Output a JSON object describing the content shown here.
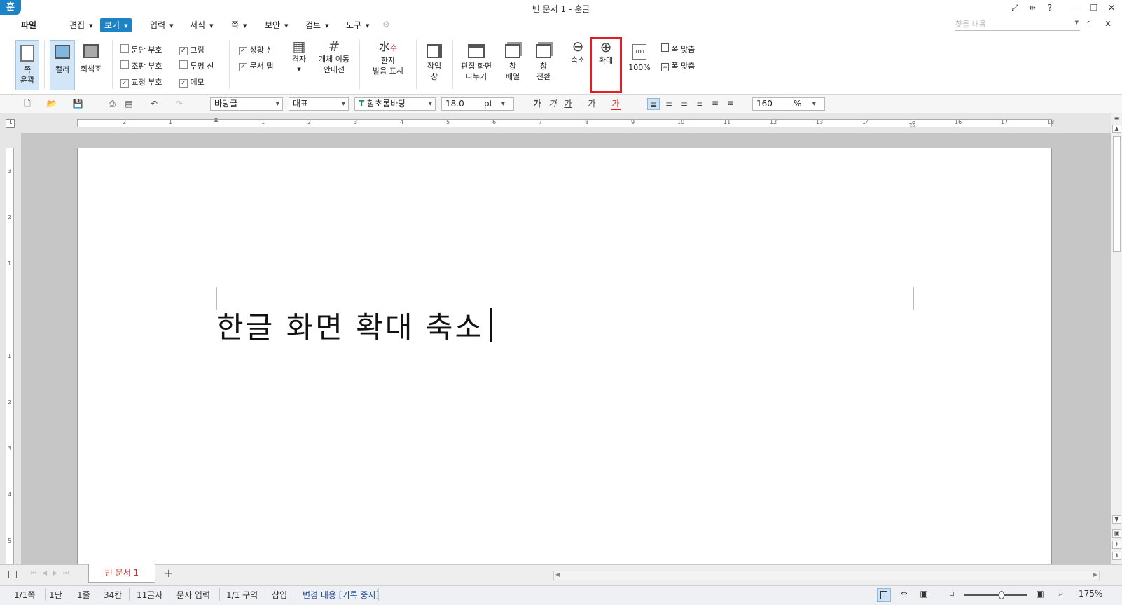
{
  "window": {
    "title": "빈 문서 1 - 훈글",
    "logo": "훈"
  },
  "title_controls": {
    "fit": "⤢",
    "split": "⇹",
    "help": "?",
    "minimize": "—",
    "restore": "❐",
    "close": "✕"
  },
  "menu": {
    "items": [
      "파일",
      "편집",
      "보기",
      "입력",
      "서식",
      "쪽",
      "보안",
      "검토",
      "도구"
    ],
    "active": "보기",
    "search_placeholder": "찾을 내용"
  },
  "ribbon": {
    "page_outline": "쪽\n윤곽",
    "color": "컬러",
    "grayscale": "회색조",
    "checks": [
      {
        "label": "문단 부호",
        "checked": false
      },
      {
        "label": "조판 부호",
        "checked": false
      },
      {
        "label": "교정 부호",
        "checked": true
      },
      {
        "label": "그림",
        "checked": true
      },
      {
        "label": "투명 선",
        "checked": false
      },
      {
        "label": "메모",
        "checked": true
      },
      {
        "label": "상황 선",
        "checked": true
      },
      {
        "label": "문서 탭",
        "checked": true
      }
    ],
    "grid": "격자",
    "object_guide": "개체 이동\n안내선",
    "hanja": "한자\n발음 표시",
    "task_pane": "작업\n창",
    "split_view": "편집 화면\n나누기",
    "arrange": "창\n배열",
    "switch": "창\n전환",
    "zoom_out": "축소",
    "zoom_in": "확대",
    "zoom_100": "100%",
    "fit_page": "쪽 맞춤",
    "fit_width": "폭 맞춤"
  },
  "toolbar": {
    "style": "바탕글",
    "lang": "대표",
    "font": "함초롬바탕",
    "size": "18.0",
    "unit": "pt",
    "zoom": "160",
    "zoom_unit": "%",
    "font_style_glyphs": [
      "가",
      "가",
      "가",
      "가",
      "가"
    ]
  },
  "ruler": {
    "h_marks": [
      "2",
      "1",
      "",
      "1",
      "2",
      "3",
      "4",
      "5",
      "6",
      "7",
      "8",
      "9",
      "10",
      "11",
      "12",
      "13",
      "14",
      "15",
      "16",
      "17",
      "18"
    ],
    "v_marks": [
      "3",
      "2",
      "1",
      "",
      "1",
      "2",
      "3",
      "4",
      "5"
    ]
  },
  "document": {
    "text": "한글 화면 확대 축소"
  },
  "doc_tab": {
    "name": "빈 문서 1",
    "add": "+"
  },
  "status": {
    "page": "1/1쪽",
    "column": "1단",
    "line": "1줄",
    "col": "34칸",
    "chars": "11글자",
    "mode": "문자 입력",
    "section": "1/1 구역",
    "insert": "삽입",
    "track": "변경 내용 [기록 중지]",
    "zoom": "175%",
    "zoom_level": 0.6
  },
  "colors": {
    "accent": "#1c84c6",
    "highlight": "#e21d24",
    "track_text": "#1f4e9a"
  }
}
